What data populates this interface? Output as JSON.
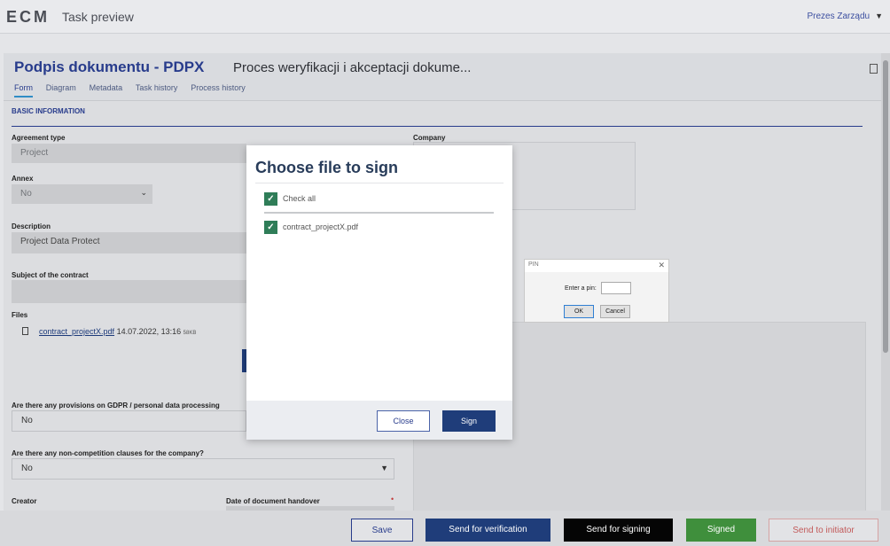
{
  "app": {
    "logo": "ECM",
    "title": "Task preview",
    "user": "Prezes Zarządu"
  },
  "document": {
    "title": "Podpis dokumentu - PDPX",
    "process": "Proces weryfikacji i akceptacji dokume..."
  },
  "tabs": [
    "Form",
    "Diagram",
    "Metadata",
    "Task history",
    "Process history"
  ],
  "form": {
    "section": "BASIC INFORMATION",
    "agreement_type_label": "Agreement type",
    "agreement_type_value": "Project",
    "annex_label": "Annex",
    "annex_value": "No",
    "description_label": "Description",
    "description_value": "Project Data Protect",
    "subject_label": "Subject of the contract",
    "files_label": "Files",
    "file": {
      "name": "contract_projectX.pdf",
      "date": "14.07.2022, 13:16",
      "size": "58KB"
    },
    "gdpr_label": "Are there any provisions on GDPR / personal data processing",
    "gdpr_value": "No",
    "noncompete_label": "Are there any non-competition clauses for the company?",
    "noncompete_value": "No",
    "creator_label": "Creator",
    "handover_label": "Date of document handover",
    "company_label": "Company"
  },
  "footer": {
    "save": "Save",
    "verification": "Send for verification",
    "signing": "Send for signing",
    "signed": "Signed",
    "initiator": "Send to initiator"
  },
  "modal": {
    "title": "Choose file to sign",
    "check_all": "Check all",
    "file": "contract_projectX.pdf",
    "close": "Close",
    "sign": "Sign"
  },
  "pin": {
    "title": "PIN",
    "label": "Enter a pin:",
    "ok": "OK",
    "cancel": "Cancel"
  },
  "colors": {
    "brand": "#283c8c",
    "primary_button": "#1f3d7a",
    "signed_green": "#3f8f3c",
    "check_green": "#2f7d58"
  }
}
